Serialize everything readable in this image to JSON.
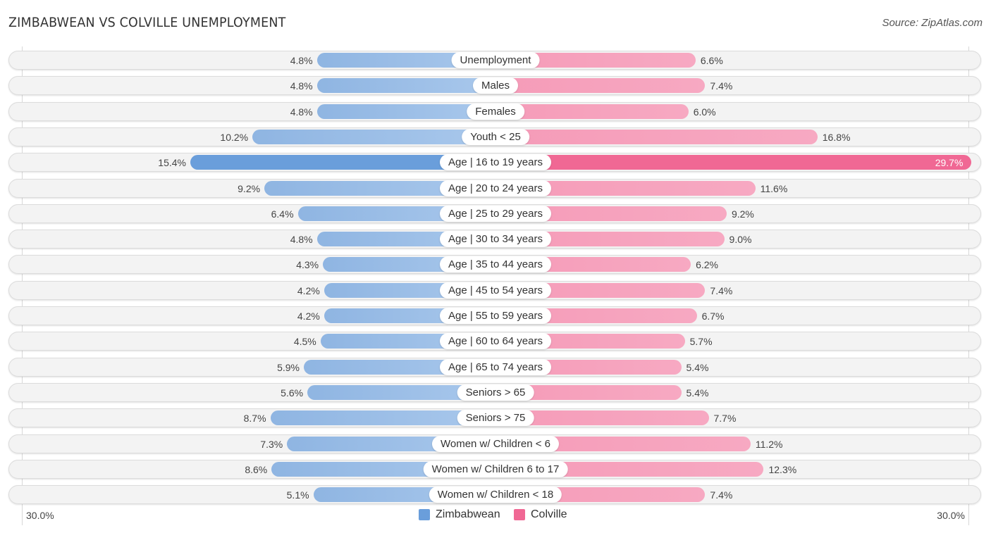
{
  "title": "ZIMBABWEAN VS COLVILLE UNEMPLOYMENT",
  "source": "Source: ZipAtlas.com",
  "chart_data": {
    "type": "bar",
    "orientation": "horizontal-diverging",
    "title": "ZIMBABWEAN VS COLVILLE UNEMPLOYMENT",
    "categories": [
      "Unemployment",
      "Males",
      "Females",
      "Youth < 25",
      "Age | 16 to 19 years",
      "Age | 20 to 24 years",
      "Age | 25 to 29 years",
      "Age | 30 to 34 years",
      "Age | 35 to 44 years",
      "Age | 45 to 54 years",
      "Age | 55 to 59 years",
      "Age | 60 to 64 years",
      "Age | 65 to 74 years",
      "Seniors > 65",
      "Seniors > 75",
      "Women w/ Children < 6",
      "Women w/ Children 6 to 17",
      "Women w/ Children < 18"
    ],
    "series": [
      {
        "name": "Zimbabwean",
        "color": "#6a9edb",
        "values": [
          4.8,
          4.8,
          4.8,
          10.2,
          15.4,
          9.2,
          6.4,
          4.8,
          4.3,
          4.2,
          4.2,
          4.5,
          5.9,
          5.6,
          8.7,
          7.3,
          8.6,
          5.1
        ],
        "labels": [
          "4.8%",
          "4.8%",
          "4.8%",
          "10.2%",
          "15.4%",
          "9.2%",
          "6.4%",
          "4.8%",
          "4.3%",
          "4.2%",
          "4.2%",
          "4.5%",
          "5.9%",
          "5.6%",
          "8.7%",
          "7.3%",
          "8.6%",
          "5.1%"
        ]
      },
      {
        "name": "Colville",
        "color": "#f06894",
        "values": [
          6.6,
          7.4,
          6.0,
          16.8,
          29.7,
          11.6,
          9.2,
          9.0,
          6.2,
          7.4,
          6.7,
          5.7,
          5.4,
          5.4,
          7.7,
          11.2,
          12.3,
          7.4
        ],
        "labels": [
          "6.6%",
          "7.4%",
          "6.0%",
          "16.8%",
          "29.7%",
          "11.6%",
          "9.2%",
          "9.0%",
          "6.2%",
          "7.4%",
          "6.7%",
          "5.7%",
          "5.4%",
          "5.4%",
          "7.7%",
          "11.2%",
          "12.3%",
          "7.4%"
        ]
      }
    ],
    "highlight_index": 4,
    "xlim": [
      -30,
      30
    ],
    "axis_tick_labels": {
      "left": "30.0%",
      "right": "30.0%"
    },
    "unit": "%",
    "legend": {
      "position": "bottom-center",
      "entries": [
        "Zimbabwean",
        "Colville"
      ]
    },
    "grid": false
  }
}
